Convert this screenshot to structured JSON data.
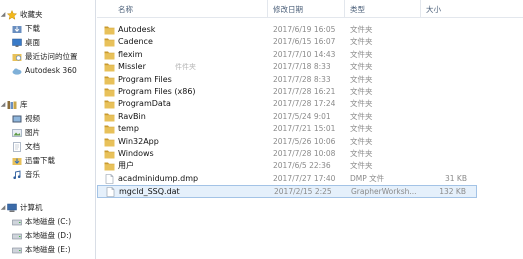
{
  "nav": {
    "favorites": {
      "label": "收藏夹",
      "items": [
        "下载",
        "桌面",
        "最近访问的位置",
        "Autodesk 360"
      ]
    },
    "libraries": {
      "label": "库",
      "items": [
        "视频",
        "图片",
        "文档",
        "迅雷下载",
        "音乐"
      ]
    },
    "computer": {
      "label": "计算机",
      "items": [
        "本地磁盘 (C:)",
        "本地磁盘 (D:)",
        "本地磁盘 (E:)"
      ]
    }
  },
  "columns": {
    "name": "名称",
    "date": "修改日期",
    "type": "类型",
    "size": "大小"
  },
  "files": [
    {
      "name": "Autodesk",
      "date": "2017/6/19 16:05",
      "type": "文件夹",
      "size": "",
      "kind": "folder"
    },
    {
      "name": "Cadence",
      "date": "2017/6/15 16:07",
      "type": "文件夹",
      "size": "",
      "kind": "folder"
    },
    {
      "name": "flexim",
      "date": "2017/7/10 14:43",
      "type": "文件夹",
      "size": "",
      "kind": "folder"
    },
    {
      "name": "Missler",
      "date": "2017/7/18 8:33",
      "type": "文件夹",
      "size": "",
      "kind": "folder",
      "ghost": "件件夹"
    },
    {
      "name": "Program Files",
      "date": "2017/7/28 8:33",
      "type": "文件夹",
      "size": "",
      "kind": "folder"
    },
    {
      "name": "Program Files (x86)",
      "date": "2017/7/28 16:21",
      "type": "文件夹",
      "size": "",
      "kind": "folder"
    },
    {
      "name": "ProgramData",
      "date": "2017/7/28 17:24",
      "type": "文件夹",
      "size": "",
      "kind": "folder"
    },
    {
      "name": "RavBin",
      "date": "2017/5/24 9:01",
      "type": "文件夹",
      "size": "",
      "kind": "folder"
    },
    {
      "name": "temp",
      "date": "2017/7/21 15:01",
      "type": "文件夹",
      "size": "",
      "kind": "folder"
    },
    {
      "name": "Win32App",
      "date": "2017/5/26 10:06",
      "type": "文件夹",
      "size": "",
      "kind": "folder"
    },
    {
      "name": "Windows",
      "date": "2017/7/28 10:08",
      "type": "文件夹",
      "size": "",
      "kind": "folder"
    },
    {
      "name": "用户",
      "date": "2017/6/5 22:36",
      "type": "文件夹",
      "size": "",
      "kind": "folder"
    },
    {
      "name": "acadminidump.dmp",
      "date": "2017/7/27 17:40",
      "type": "DMP 文件",
      "size": "31 KB",
      "kind": "file"
    },
    {
      "name": "mgcld_SSQ.dat",
      "date": "2017/2/15 2:25",
      "type": "GrapherWorksh...",
      "size": "132 KB",
      "kind": "file",
      "selected": true
    }
  ],
  "colors": {
    "folder": "#e8c15a",
    "folder_dark": "#c99a2e",
    "selection_bg": "#e5f0fb",
    "selection_border": "#a3c3e6",
    "star": "#f2b81c"
  }
}
